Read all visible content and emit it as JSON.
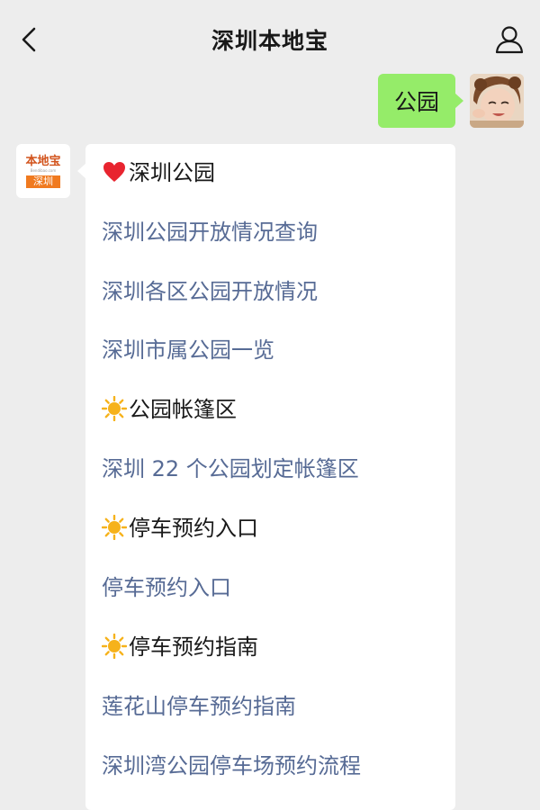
{
  "header": {
    "title": "深圳本地宝"
  },
  "outgoing": {
    "text": "公园"
  },
  "bot_avatar": {
    "logo_top": "本地宝",
    "logo_mid": "Bendibao.com",
    "logo_bottom": "深圳"
  },
  "reply": {
    "lines": [
      {
        "kind": "heading",
        "icon": "heart-icon",
        "text": "深圳公园"
      },
      {
        "kind": "link",
        "text": "深圳公园开放情况查询"
      },
      {
        "kind": "link",
        "text": "深圳各区公园开放情况"
      },
      {
        "kind": "link",
        "text": "深圳市属公园一览"
      },
      {
        "kind": "heading",
        "icon": "sun-icon",
        "text": "公园帐篷区"
      },
      {
        "kind": "link",
        "text": "深圳 22 个公园划定帐篷区"
      },
      {
        "kind": "heading",
        "icon": "sun-icon",
        "text": "停车预约入口"
      },
      {
        "kind": "link",
        "text": "停车预约入口"
      },
      {
        "kind": "heading",
        "icon": "sun-icon",
        "text": "停车预约指南"
      },
      {
        "kind": "link",
        "text": "莲花山停车预约指南"
      },
      {
        "kind": "link",
        "text": "深圳湾公园停车场预约流程"
      }
    ]
  },
  "colors": {
    "background": "#ededed",
    "outgoing_bubble": "#95ec69",
    "link": "#576b95",
    "heart": "#e8242f",
    "sun": "#f6b21b"
  }
}
